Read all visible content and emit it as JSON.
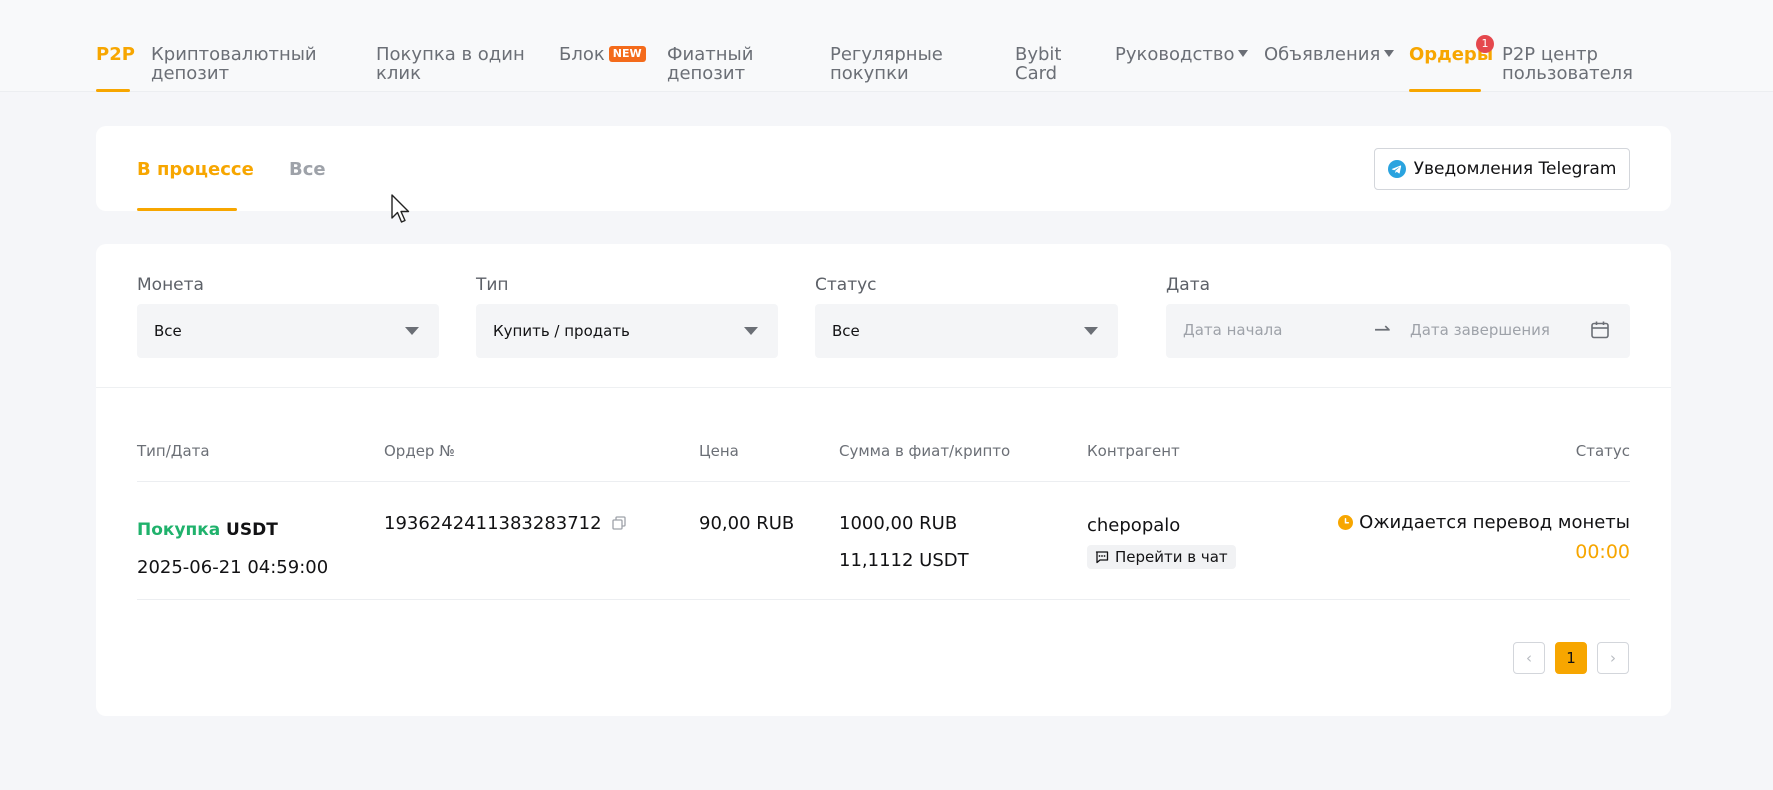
{
  "nav": {
    "p2p": "P2P",
    "crypto_deposit": "Криптовалютный депозит",
    "one_click": "Покупка в один клик",
    "block": "Блок",
    "block_tag": "NEW",
    "fiat_deposit": "Фиатный депозит",
    "recurring": "Регулярные покупки",
    "bybit_card": "Bybit Card",
    "guide": "Руководство",
    "ads": "Объявления",
    "orders": "Ордеры",
    "orders_badge": "1",
    "user_center": "P2P центр пользователя"
  },
  "tabs": {
    "in_progress": "В процессе",
    "all": "Все",
    "telegram": "Уведомления Telegram"
  },
  "filters": {
    "coin_label": "Монета",
    "coin_value": "Все",
    "type_label": "Тип",
    "type_value": "Купить / продать",
    "status_label": "Статус",
    "status_value": "Все",
    "date_label": "Дата",
    "date_start_placeholder": "Дата начала",
    "date_end_placeholder": "Дата завершения"
  },
  "table": {
    "headers": [
      "Тип/Дата",
      "Ордер №",
      "Цена",
      "Сумма в фиат/крипто",
      "Контрагент",
      "Статус"
    ],
    "rows": [
      {
        "side": "Покупка",
        "coin": "USDT",
        "datetime": "2025-06-21 04:59:00",
        "order_no": "1936242411383283712",
        "price": "90,00 RUB",
        "fiat_amount": "1000,00 RUB",
        "crypto_amount": "11,1112 USDT",
        "counterparty": "chepopalo",
        "chat_label": "Перейти в чат",
        "status": "Ожидается перевод монеты",
        "timer": "00:00"
      }
    ]
  },
  "pagination": {
    "prev": "‹",
    "current": "1",
    "next": "›"
  },
  "colors": {
    "accent": "#f7a600",
    "buy": "#20b26c",
    "badge": "#e5484d",
    "new_tag": "#f46b1b"
  }
}
